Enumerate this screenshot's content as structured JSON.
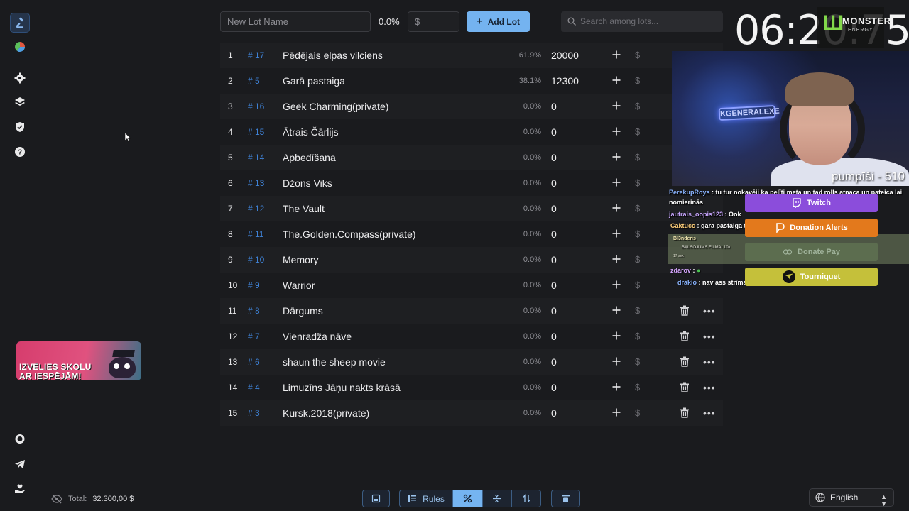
{
  "sidebar": {
    "items": [
      {
        "name": "auction-icon",
        "active": true
      },
      {
        "name": "pie-chart-icon"
      },
      {
        "name": "gear-icon"
      },
      {
        "name": "layers-icon"
      },
      {
        "name": "shield-icon"
      },
      {
        "name": "help-icon"
      }
    ],
    "bottom": [
      "github-icon",
      "telegram-icon",
      "donate-hand-icon"
    ]
  },
  "promo": {
    "text_line1": "IZVĒLIES SKOLU",
    "text_line2": "AR IESPĒJĀM!"
  },
  "footer": {
    "total_label": "Total:",
    "total_value": "32.300,00 $"
  },
  "toolbar": {
    "new_lot_placeholder": "New Lot Name",
    "percent": "0.0%",
    "amount_placeholder": "$",
    "add_lot_label": "Add Lot",
    "search_placeholder": "Search among lots..."
  },
  "lots": [
    {
      "num": "1",
      "id": "# 17",
      "name": "Pēdējais elpas vilciens",
      "percent": "61.9%",
      "amount": "20000"
    },
    {
      "num": "2",
      "id": "# 5",
      "name": "Garā pastaiga",
      "percent": "38.1%",
      "amount": "12300"
    },
    {
      "num": "3",
      "id": "# 16",
      "name": "Geek Charming(private)",
      "percent": "0.0%",
      "amount": "0"
    },
    {
      "num": "4",
      "id": "# 15",
      "name": "Ātrais Čārlijs",
      "percent": "0.0%",
      "amount": "0"
    },
    {
      "num": "5",
      "id": "# 14",
      "name": "Apbedīšana",
      "percent": "0.0%",
      "amount": "0"
    },
    {
      "num": "6",
      "id": "# 13",
      "name": "Džons Viks",
      "percent": "0.0%",
      "amount": "0"
    },
    {
      "num": "7",
      "id": "# 12",
      "name": "The Vault",
      "percent": "0.0%",
      "amount": "0"
    },
    {
      "num": "8",
      "id": "# 11",
      "name": "The.Golden.Compass(private)",
      "percent": "0.0%",
      "amount": "0"
    },
    {
      "num": "9",
      "id": "# 10",
      "name": "Memory",
      "percent": "0.0%",
      "amount": "0"
    },
    {
      "num": "10",
      "id": "# 9",
      "name": "Warrior",
      "percent": "0.0%",
      "amount": "0"
    },
    {
      "num": "11",
      "id": "# 8",
      "name": "Dārgums",
      "percent": "0.0%",
      "amount": "0"
    },
    {
      "num": "12",
      "id": "# 7",
      "name": "Vienradža nāve",
      "percent": "0.0%",
      "amount": "0"
    },
    {
      "num": "13",
      "id": "# 6",
      "name": "shaun the sheep movie",
      "percent": "0.0%",
      "amount": "0"
    },
    {
      "num": "14",
      "id": "# 4",
      "name": "Limuzīns Jāņu nakts krāsā",
      "percent": "0.0%",
      "amount": "0"
    },
    {
      "num": "15",
      "id": "# 3",
      "name": "Kursk.2018(private)",
      "percent": "0.0%",
      "amount": "0"
    }
  ],
  "bottom_bar": {
    "rules_label": "Rules"
  },
  "language": {
    "selected": "English"
  },
  "overlay": {
    "clock": "06:20:75",
    "monster_brand": "MONSTER",
    "monster_sub": "ENERGY",
    "neon_sign": "KGENERALEXE",
    "cam_caption": "pumpīši - 510",
    "chat": [
      {
        "user": "PerekupRoys",
        "text": ": tu tur nokavēji ka pelīti meta un tad rolls atnaca un pateica lai",
        "cont": "nomierinās"
      },
      {
        "user": "jautrais_oopis123",
        "text": ": Ook"
      },
      {
        "user": "Caktucc",
        "text": ": gara pastaiga tik ass"
      },
      {
        "user": "Bl3nderis",
        "text": "BALSOJUMS FILMAI 10k",
        "time": "17 sek"
      },
      {
        "user": "zdarov",
        "text": ":"
      },
      {
        "user": "drakio",
        "text": ": nav ass strīmam"
      }
    ],
    "buttons": {
      "twitch": "Twitch",
      "donation_alerts": "Donation Alerts",
      "donate_pay": "Donate Pay",
      "tourniquet": "Tourniquet"
    }
  },
  "colors": {
    "accent": "#74b3f0",
    "id_color": "#3f82d6",
    "twitch": "#8b4ddb",
    "donation_alerts": "#e3791c",
    "tourniquet": "#c5c03a"
  }
}
